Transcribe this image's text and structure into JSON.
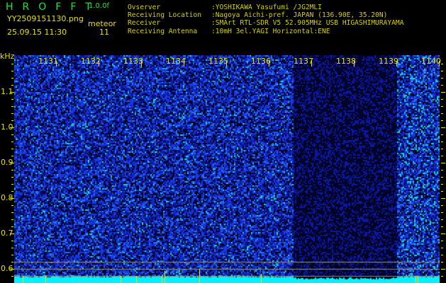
{
  "header": {
    "app_name": "HROFFT",
    "version": "1.0.0f",
    "filename": "YY2509151130.png",
    "datetime": "25.09.15 11:30",
    "counter_label": "meteor",
    "counter_value": "11",
    "info": [
      {
        "label": "Ovserver",
        "value": ":YOSHIKAWA Yasufumi /JG2MLI"
      },
      {
        "label": "Receiving Location",
        "value": ":Nagoya Aichi-pref. JAPAN (136.90E, 35.20N)"
      },
      {
        "label": "Receiver",
        "value": ":SMArt RTL-SDR V5 52.905MHz USB HIGASHIMURAYAMA"
      },
      {
        "label": "Receiving Antenna",
        "value": ":10mH 3el.YAGI Horizontal:ENE"
      }
    ]
  },
  "spectrogram": {
    "y_unit": "kHz",
    "y_ticks": [
      "1.1",
      "1.0",
      "0.9",
      "0.8",
      "0.7",
      "0.6"
    ],
    "time_labels": [
      "1131",
      "1132",
      "1133",
      "1134",
      "1135",
      "1136",
      "1137",
      "1138",
      "1139",
      "1140"
    ],
    "colors": {
      "text": "#e8e000",
      "noise": "#1030e0",
      "baseline": "#00f0ff",
      "grid": "#909090"
    }
  }
}
